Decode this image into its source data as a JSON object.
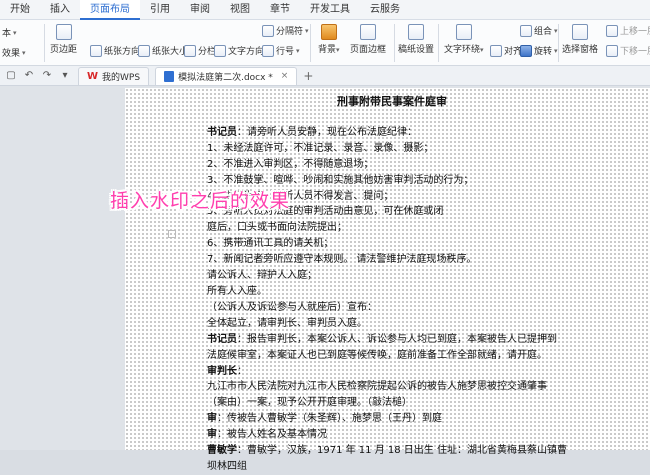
{
  "menu": {
    "tabs": [
      "开始",
      "插入",
      "页面布局",
      "引用",
      "审阅",
      "视图",
      "章节",
      "开发工具",
      "云服务"
    ],
    "active_index": 2
  },
  "ribbon": {
    "theme_label": "本",
    "effect_label": "效果",
    "margin_label": "页边距",
    "orientation_label": "纸张方向",
    "size_label": "纸张大小",
    "columns_label": "分栏",
    "text_dir_label": "文字方向",
    "breaks_label": "分隔符",
    "line_num_label": "行号",
    "background_label": "背景",
    "page_border_label": "页面边框",
    "manuscript_label": "稿纸设置",
    "wrap_label": "文字环绕",
    "align_label": "对齐",
    "rotate_label": "旋转",
    "group_label": "组合",
    "select_pane_label": "选择窗格",
    "bring_up_label": "上移一层",
    "send_down_label": "下移一层"
  },
  "tabbar": {
    "home_tab": "我的WPS",
    "doc_tab": "模拟法庭第二次.docx *",
    "close": "×",
    "new_tab": "+"
  },
  "watermark": "插入水印之后的效果",
  "document": {
    "title": "刑事附带民事案件庭审",
    "lines": [
      {
        "bold_prefix": "书记员",
        "text": "：请旁听人员安静，现在公布法庭纪律："
      },
      {
        "bold_prefix": "",
        "text": "1、未经法庭许可，不准记录、录音、录像、摄影；"
      },
      {
        "bold_prefix": "",
        "text": "2、不准进入审判区，不得随意退场；"
      },
      {
        "bold_prefix": "",
        "text": "3、不准鼓掌、喧哗、吵闹和实施其他妨害审判活动的行为；"
      },
      {
        "bold_prefix": "",
        "text": "4、未经许可，旁听人员不得发言、提问；"
      },
      {
        "bold_prefix": "",
        "text": "5、旁听人员对法庭的审判活动由意见，可在休庭或闭"
      },
      {
        "bold_prefix": "",
        "text": "庭后，口头或书面向法院提出；"
      },
      {
        "bold_prefix": "",
        "text": "6、携带通讯工具的请关机；"
      },
      {
        "bold_prefix": "",
        "text": "7、新闻记者旁听应遵守本规则。    请法警维护法庭现场秩序。"
      },
      {
        "bold_prefix": "",
        "text": "请公诉人、辩护人入庭；"
      },
      {
        "bold_prefix": "",
        "text": "所有人入座。"
      },
      {
        "bold_prefix": "",
        "text": "（公诉人及诉讼参与人就座后）宣布："
      },
      {
        "bold_prefix": "",
        "text": "全体起立，请审判长、审判员入庭。"
      },
      {
        "bold_prefix": "书记员",
        "text": "：报告审判长，本案公诉人、诉讼参与人均已到庭，本案被告人已提押到"
      },
      {
        "bold_prefix": "",
        "text": "法庭候审室，本案证人也已到庭等候传唤，庭前准备工作全部就绪，请开庭。"
      },
      {
        "bold_prefix": "审判长",
        "text": "："
      },
      {
        "bold_prefix": "",
        "text": " 九江市市人民法院对九江市人民检察院提起公诉的被告人施梦思被控交通肇事"
      },
      {
        "bold_prefix": "",
        "text": "（案由）一案，现予公开开庭审理。（敲法槌）"
      },
      {
        "bold_prefix": "审",
        "text": "：传被告人曹敏学（朱圣辉）、施梦思（王丹）到庭"
      },
      {
        "bold_prefix": "审",
        "text": "：被告人姓名及基本情况"
      },
      {
        "bold_prefix": "曹敏学",
        "text": "：曹敏学，汉族，1971 年 11 月 18 日出生 住址：湖北省黄梅县蔡山镇曹"
      },
      {
        "bold_prefix": "",
        "text": "坝林四组"
      }
    ]
  }
}
